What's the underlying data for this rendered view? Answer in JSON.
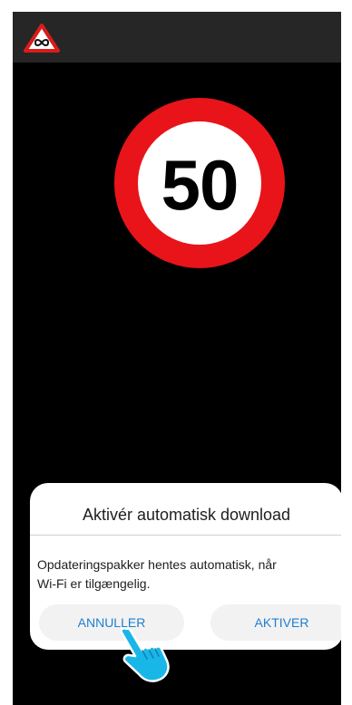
{
  "app_bar": {
    "icon": "infinity-warning-triangle-icon"
  },
  "speed_sign": {
    "value": "50",
    "ring_color": "#e8141a"
  },
  "dialog": {
    "title": "Aktivér automatisk download",
    "message_line1": "Opdateringspakker hentes automatisk, når",
    "message_line2": "Wi-Fi er tilgængelig.",
    "cancel_label": "ANNULLER",
    "confirm_label": "AKTIVER",
    "accent_color": "#1e7fd1"
  },
  "overlay": {
    "pointer_icon": "tap-hand-icon",
    "pointer_color": "#19b7e8"
  }
}
